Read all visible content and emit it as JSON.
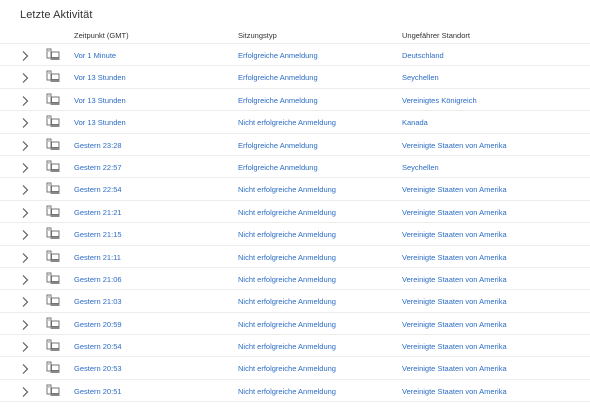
{
  "section_title": "Letzte Aktivität",
  "columns": {
    "time": "Zeitpunkt (GMT)",
    "type": "Sitzungstyp",
    "location": "Ungefährer Standort"
  },
  "icons": {
    "expand": "chevron-right-icon",
    "device": "computer-icon"
  },
  "colors": {
    "link": "#2b6cc4",
    "divider": "#ededed"
  },
  "rows": [
    {
      "time": "Vor 1 Minute",
      "type": "Erfolgreiche Anmeldung",
      "location": "Deutschland"
    },
    {
      "time": "Vor 13 Stunden",
      "type": "Erfolgreiche Anmeldung",
      "location": "Seychellen"
    },
    {
      "time": "Vor 13 Stunden",
      "type": "Erfolgreiche Anmeldung",
      "location": "Vereinigtes Königreich"
    },
    {
      "time": "Vor 13 Stunden",
      "type": "Nicht erfolgreiche Anmeldung",
      "location": "Kanada"
    },
    {
      "time": "Gestern 23:28",
      "type": "Erfolgreiche Anmeldung",
      "location": "Vereinigte Staaten von Amerika"
    },
    {
      "time": "Gestern 22:57",
      "type": "Erfolgreiche Anmeldung",
      "location": "Seychellen"
    },
    {
      "time": "Gestern 22:54",
      "type": "Nicht erfolgreiche Anmeldung",
      "location": "Vereinigte Staaten von Amerika"
    },
    {
      "time": "Gestern 21:21",
      "type": "Nicht erfolgreiche Anmeldung",
      "location": "Vereinigte Staaten von Amerika"
    },
    {
      "time": "Gestern 21:15",
      "type": "Nicht erfolgreiche Anmeldung",
      "location": "Vereinigte Staaten von Amerika"
    },
    {
      "time": "Gestern 21:11",
      "type": "Nicht erfolgreiche Anmeldung",
      "location": "Vereinigte Staaten von Amerika"
    },
    {
      "time": "Gestern 21:06",
      "type": "Nicht erfolgreiche Anmeldung",
      "location": "Vereinigte Staaten von Amerika"
    },
    {
      "time": "Gestern 21:03",
      "type": "Nicht erfolgreiche Anmeldung",
      "location": "Vereinigte Staaten von Amerika"
    },
    {
      "time": "Gestern 20:59",
      "type": "Nicht erfolgreiche Anmeldung",
      "location": "Vereinigte Staaten von Amerika"
    },
    {
      "time": "Gestern 20:54",
      "type": "Nicht erfolgreiche Anmeldung",
      "location": "Vereinigte Staaten von Amerika"
    },
    {
      "time": "Gestern 20:53",
      "type": "Nicht erfolgreiche Anmeldung",
      "location": "Vereinigte Staaten von Amerika"
    },
    {
      "time": "Gestern 20:51",
      "type": "Nicht erfolgreiche Anmeldung",
      "location": "Vereinigte Staaten von Amerika"
    }
  ]
}
